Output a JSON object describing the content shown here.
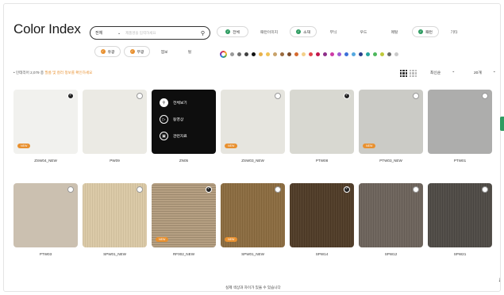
{
  "page_title": "Color Index",
  "search": {
    "category": "전체",
    "placeholder": "제품명을 입력하세요",
    "caret": "⌄",
    "icon": "search-icon"
  },
  "filters_row1": [
    {
      "label": "전체",
      "selected": true
    },
    {
      "label": "패턴이미지",
      "selected": false
    },
    {
      "label": "소재",
      "selected": true
    },
    {
      "label": "무늬",
      "selected": false
    },
    {
      "label": "우드",
      "selected": false
    },
    {
      "label": "메탈",
      "selected": false
    },
    {
      "label": "패턴",
      "selected": true
    },
    {
      "label": "기타",
      "selected": false
    }
  ],
  "filters_row2": [
    {
      "label": "유광",
      "selected": true
    },
    {
      "label": "무광",
      "selected": true
    },
    {
      "label": "엠보",
      "selected": false
    },
    {
      "label": "펄",
      "selected": false
    }
  ],
  "swatch_colors": [
    "#9a9a9a",
    "#6f6f6f",
    "#3f3f3f",
    "#111111",
    "#e8b04a",
    "#f0c357",
    "#c9a36b",
    "#9a6b3e",
    "#7a4a2a",
    "#d66a2e",
    "#f3d089",
    "#e0444a",
    "#c2164b",
    "#8e2f8a",
    "#ce3aa6",
    "#9f5bd2",
    "#3b6fd9",
    "#55a8e0",
    "#2b3f8c",
    "#27a6a0",
    "#4db85c",
    "#bfc93a",
    "#6a6a6a",
    "#c9c9c9"
  ],
  "info": {
    "prefix": "• 인테리어 2,079 종",
    "highlight": "필름 및 컬러 정보를 확인하세요"
  },
  "sort": {
    "order": "최신순",
    "per_page": "20개"
  },
  "products_row1": [
    {
      "name": "ZSW04_NEW",
      "color": "#f1f1ee",
      "checked": true,
      "badge": "NEW",
      "texture": "none"
    },
    {
      "name": "PW09",
      "color": "#ebeae4",
      "checked": false,
      "badge": "",
      "texture": "none"
    },
    {
      "name": "ZN05",
      "color": "#0e0e0e",
      "checked": false,
      "badge": "",
      "texture": "overlay"
    },
    {
      "name": "ZSW03_NEW",
      "color": "#e6e5df",
      "checked": false,
      "badge": "NEW",
      "texture": "none"
    },
    {
      "name": "PTW08",
      "color": "#d8d8d1",
      "checked": true,
      "badge": "",
      "texture": "none"
    },
    {
      "name": "PTW03_NEW",
      "color": "#cbcbc6",
      "checked": false,
      "badge": "NEW",
      "texture": "none"
    },
    {
      "name": "PTW01",
      "color": "#adadac",
      "checked": false,
      "badge": "",
      "texture": "none"
    }
  ],
  "products_row2": [
    {
      "name": "PTW03",
      "color": "#cbc0b0",
      "checked": false,
      "badge": "",
      "texture": "none"
    },
    {
      "name": "SPW01_NEW",
      "color": "#dac8a4",
      "checked": false,
      "badge": "",
      "texture": "vert"
    },
    {
      "name": "RF002_NEW",
      "color": "#b29b7c",
      "checked": true,
      "badge": "NEW",
      "texture": "horz"
    },
    {
      "name": "SPW01_NEW",
      "color": "#8a6a3e",
      "checked": false,
      "badge": "NEW",
      "texture": "vert"
    },
    {
      "name": "SPW14",
      "color": "#4e3a26",
      "checked": true,
      "badge": "",
      "texture": "vert"
    },
    {
      "name": "SPW12",
      "color": "#6b625a",
      "checked": false,
      "badge": "",
      "texture": "vert"
    },
    {
      "name": "SPW21",
      "color": "#4d4944",
      "checked": false,
      "badge": "",
      "texture": "vert"
    }
  ],
  "overlay_menu": [
    {
      "label": "전체보기",
      "icon": "search-icon"
    },
    {
      "label": "동영상",
      "icon": "play-icon"
    },
    {
      "label": "관련자료",
      "icon": "document-icon"
    }
  ],
  "tooltip": "실제 색상과 차이가 있을 수 있습니다",
  "accent_green": "#2e9c61",
  "accent_orange": "#e8902f"
}
